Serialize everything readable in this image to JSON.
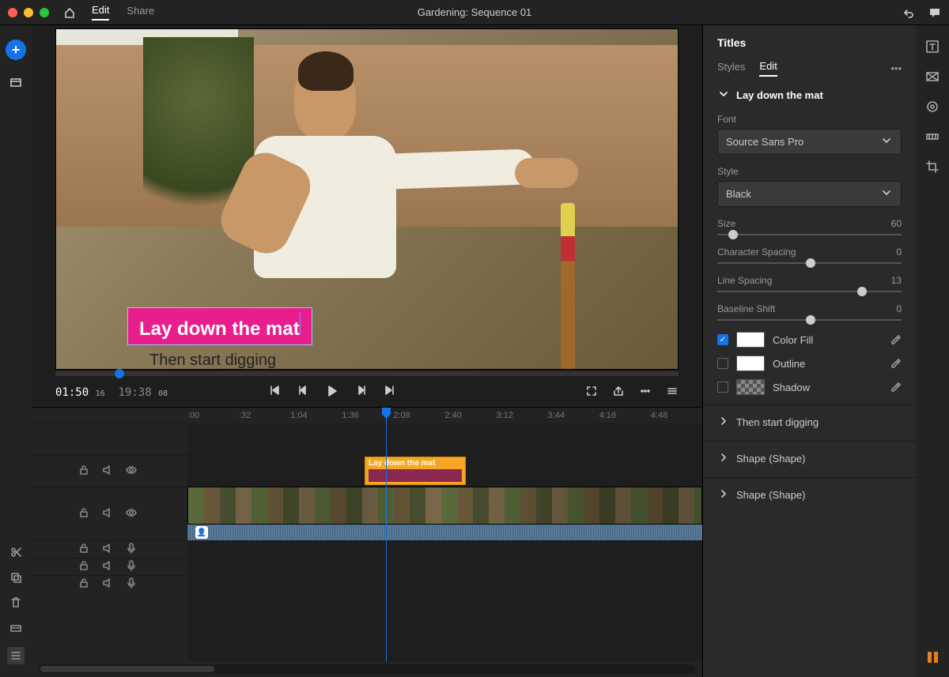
{
  "app": {
    "title": "Gardening: Sequence 01",
    "tabs": {
      "edit": "Edit",
      "share": "Share"
    }
  },
  "preview": {
    "title_text": "Lay down the mat",
    "subtitle_text": "Then start digging",
    "timecode_current": "01:50",
    "timecode_current_frames": "16",
    "timecode_duration": "19:38",
    "timecode_duration_frames": "08"
  },
  "timeline": {
    "ruler": [
      ":00",
      ":32",
      "1:04",
      "1:36",
      "2:08",
      "2:40",
      "3:12",
      "3:44",
      "4:16",
      "4:48"
    ],
    "title_clip_label": "Lay down the mat"
  },
  "titles_panel": {
    "heading": "Titles",
    "tabs": {
      "styles": "Styles",
      "edit": "Edit"
    },
    "section_name": "Lay down the mat",
    "font_label": "Font",
    "font_value": "Source Sans Pro",
    "style_label": "Style",
    "style_value": "Black",
    "size_label": "Size",
    "size_value": "60",
    "charspacing_label": "Character Spacing",
    "charspacing_value": "0",
    "linespacing_label": "Line Spacing",
    "linespacing_value": "13",
    "baseline_label": "Baseline Shift",
    "baseline_value": "0",
    "colorfill_label": "Color Fill",
    "outline_label": "Outline",
    "shadow_label": "Shadow",
    "sections": {
      "then_start_digging": "Then start digging",
      "shape1": "Shape (Shape)",
      "shape2": "Shape (Shape)"
    }
  }
}
